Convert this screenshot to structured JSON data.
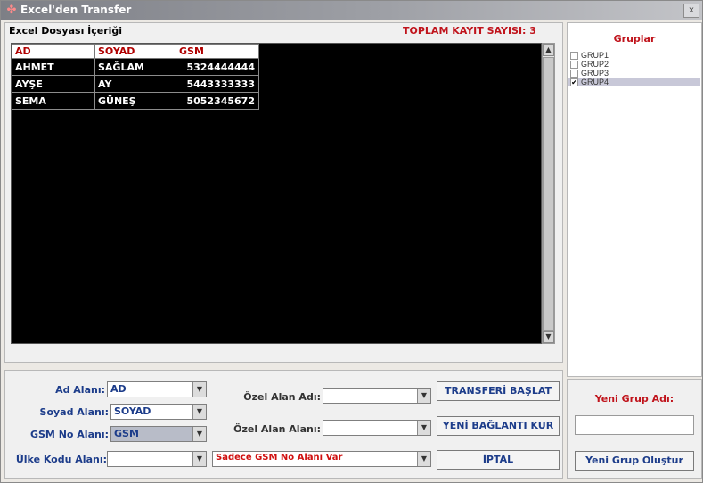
{
  "window": {
    "title": "Excel'den Transfer",
    "icon": "app-icon",
    "close_glyph": "x"
  },
  "excel": {
    "label": "Excel Dosyası İçeriği",
    "total_label": "TOPLAM KAYIT SAYISI: 3",
    "columns": [
      "AD",
      "SOYAD",
      "GSM"
    ],
    "rows": [
      [
        "AHMET",
        "SAĞLAM",
        "5324444444"
      ],
      [
        "AYŞE",
        "AY",
        "5443333333"
      ],
      [
        "SEMA",
        "GÜNEŞ",
        "5052345672"
      ]
    ]
  },
  "groups": {
    "title": "Gruplar",
    "items": [
      {
        "label": "GRUP1",
        "checked": false
      },
      {
        "label": "GRUP2",
        "checked": false
      },
      {
        "label": "GRUP3",
        "checked": false
      },
      {
        "label": "GRUP4",
        "checked": true
      }
    ]
  },
  "mapping": {
    "ad_label": "Ad Alanı:",
    "ad_value": "AD",
    "soyad_label": "Soyad Alanı:",
    "soyad_value": "SOYAD",
    "gsm_label": "GSM No Alanı:",
    "gsm_value": "GSM",
    "ulke_label": "Ülke Kodu Alanı:",
    "ulke_value": "",
    "ozel_adi_label": "Özel Alan Adı:",
    "ozel_adi_value": "",
    "ozel_alan_label": "Özel Alan Alanı:",
    "ozel_alan_value": "",
    "mode_value": "Sadece GSM No Alanı Var"
  },
  "buttons": {
    "start": "TRANSFERİ BAŞLAT",
    "new_connection": "YENİ BAĞLANTI KUR",
    "cancel": "İPTAL",
    "new_group": "Yeni Grup Oluştur"
  },
  "new_group": {
    "label": "Yeni Grup Adı:",
    "value": ""
  },
  "colors": {
    "accent_red": "#c0141c",
    "label_blue": "#1c3c8a",
    "grid_bg": "#000000"
  }
}
